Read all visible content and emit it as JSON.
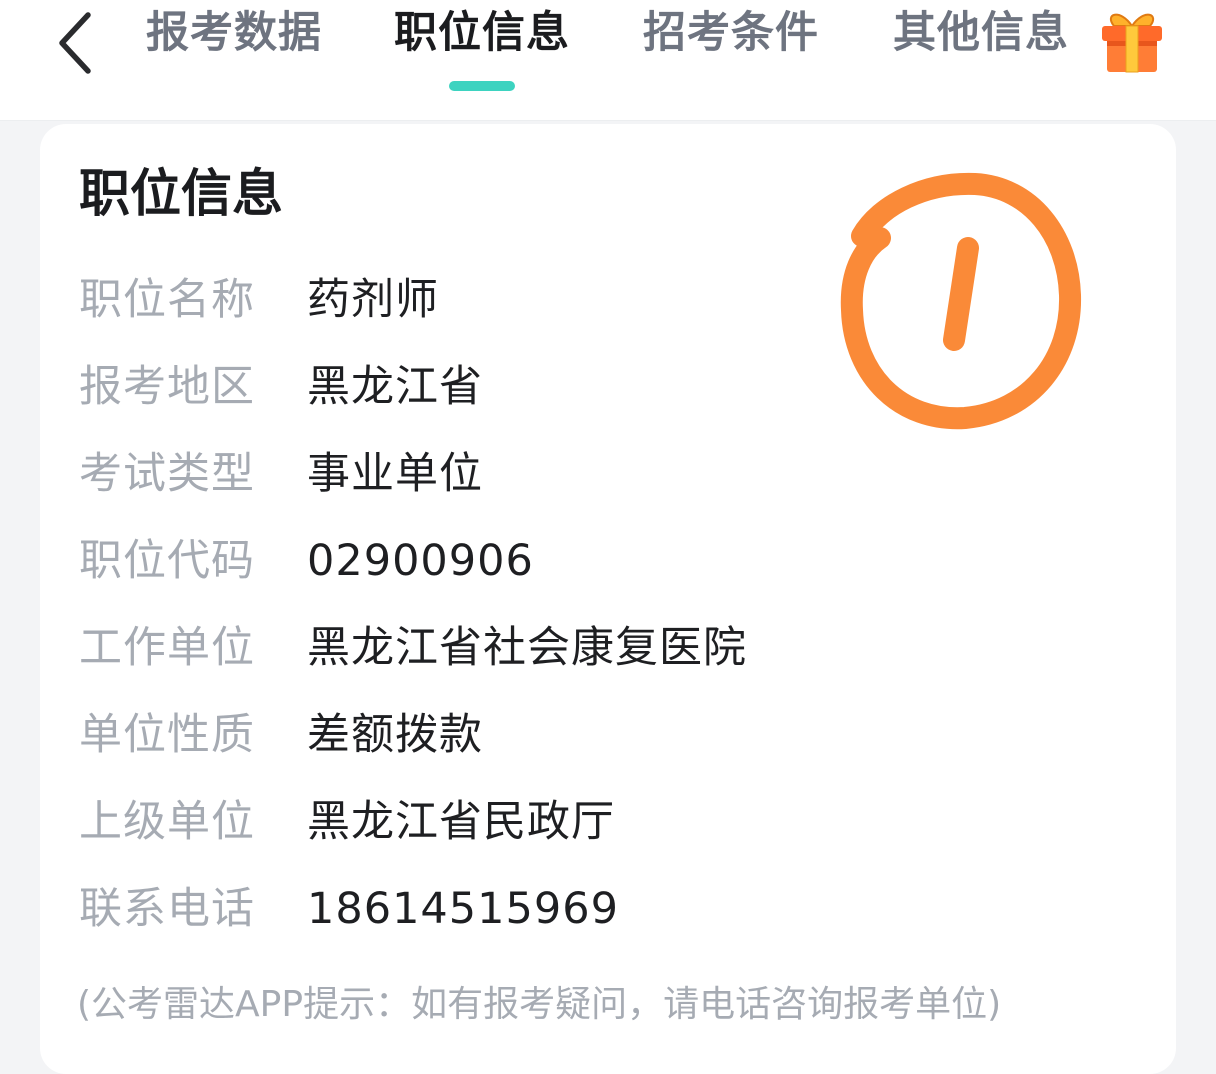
{
  "header": {
    "tabs": [
      {
        "label": "报考数据"
      },
      {
        "label": "职位信息"
      },
      {
        "label": "招考条件"
      },
      {
        "label": "其他信息"
      }
    ],
    "active_tab_index": 1,
    "accent_color": "#3dd3c0"
  },
  "card": {
    "title": "职位信息",
    "rows": [
      {
        "label": "职位名称",
        "value": "药剂师"
      },
      {
        "label": "报考地区",
        "value": "黑龙江省"
      },
      {
        "label": "考试类型",
        "value": "事业单位"
      },
      {
        "label": "职位代码",
        "value": "02900906"
      },
      {
        "label": "工作单位",
        "value": "黑龙江省社会康复医院"
      },
      {
        "label": "单位性质",
        "value": "差额拨款"
      },
      {
        "label": "上级单位",
        "value": "黑龙江省民政厅"
      },
      {
        "label": "联系电话",
        "value": "18614515969"
      }
    ],
    "note": "(公考雷达APP提示：如有报考疑问，请电话咨询报考单位)"
  },
  "annotation": {
    "text": "1",
    "color": "#fa8a38"
  },
  "icons": {
    "back": "chevron-left-icon",
    "gift": "gift-icon"
  }
}
